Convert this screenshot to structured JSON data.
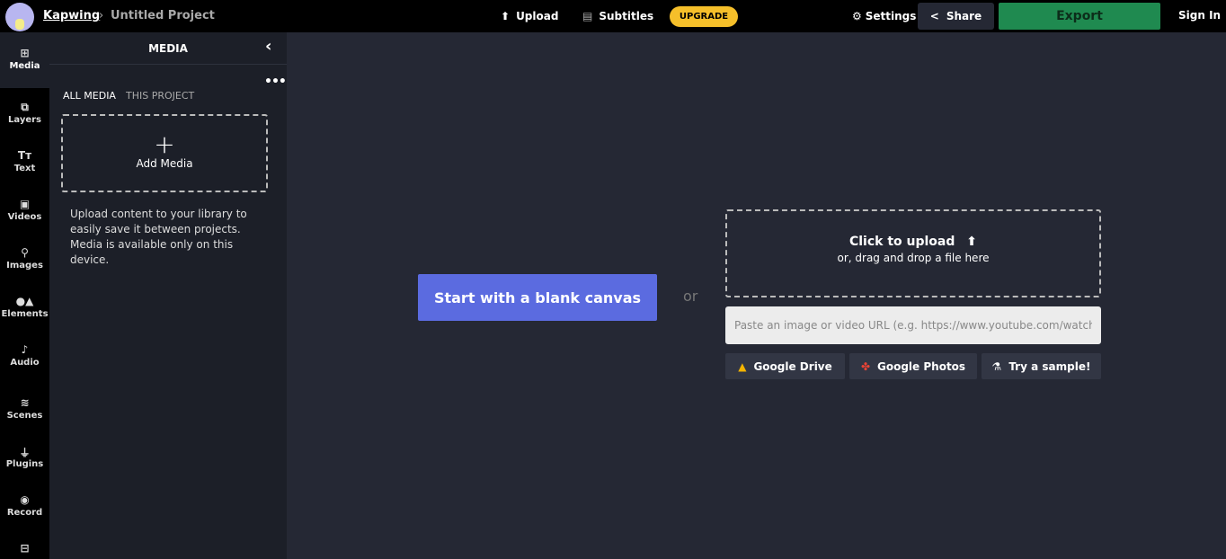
{
  "header": {
    "brand": "Kapwing",
    "separator": "›",
    "project": "Untitled Project",
    "upload": "Upload",
    "subtitles": "Subtitles",
    "upgrade": "UPGRADE",
    "settings": "Settings",
    "share": "Share",
    "export": "Export",
    "sign_in": "Sign In"
  },
  "rail": [
    {
      "label": "Media",
      "icon": "media-plus-icon"
    },
    {
      "label": "Layers",
      "icon": "layers-icon"
    },
    {
      "label": "Text",
      "icon": "text-icon"
    },
    {
      "label": "Videos",
      "icon": "video-icon"
    },
    {
      "label": "Images",
      "icon": "search-icon"
    },
    {
      "label": "Elements",
      "icon": "shapes-icon"
    },
    {
      "label": "Audio",
      "icon": "music-note-icon"
    },
    {
      "label": "Scenes",
      "icon": "stack-icon"
    },
    {
      "label": "Plugins",
      "icon": "plug-icon"
    },
    {
      "label": "Record",
      "icon": "record-icon"
    },
    {
      "label": "",
      "icon": "layout-icon"
    }
  ],
  "panel": {
    "title": "MEDIA",
    "tabs": [
      "ALL MEDIA",
      "THIS PROJECT"
    ],
    "add_media": "Add Media",
    "info": "Upload content to your library to easily save it between projects. Media is available only on this device."
  },
  "main": {
    "blank_canvas": "Start with a blank canvas",
    "or": "or",
    "click_upload": "Click to upload",
    "drag_drop": "or, drag and drop a file here",
    "url_placeholder": "Paste an image or video URL (e.g. https://www.youtube.com/watch?v=C",
    "google_drive": "Google Drive",
    "google_photos": "Google Photos",
    "try_sample": "Try a sample!"
  },
  "colors": {
    "accent": "#5b6be0",
    "export": "#1f8a50",
    "upgrade": "#f5bf2a"
  }
}
